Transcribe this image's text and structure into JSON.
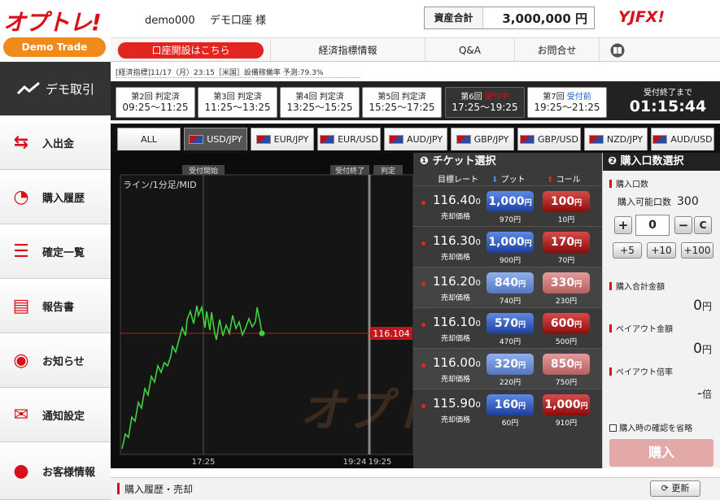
{
  "header": {
    "logo": "オプトレ!",
    "demo_badge": "Demo Trade",
    "user_id": "demo000",
    "user_name": "デモ口座 様",
    "asset_label": "資産合計",
    "asset_value": "3,000,000 円",
    "brand": "YJFX!"
  },
  "topnav": {
    "open_account": "口座開設はこちら",
    "items": [
      "経済指標情報",
      "Q&A",
      "お問合せ"
    ]
  },
  "news": "[経済指標]11/17（月）23:15［米国］設備稼働率 予測:79.3%",
  "sidebar": {
    "title": "デモ取引",
    "items": [
      "入出金",
      "購入履歴",
      "確定一覧",
      "報告書",
      "お知らせ",
      "通知設定",
      "お客様情報"
    ]
  },
  "rounds": [
    {
      "label": "第2回",
      "status": "判定済",
      "time": "09:25〜11:25"
    },
    {
      "label": "第3回",
      "status": "判定済",
      "time": "11:25〜13:25"
    },
    {
      "label": "第4回",
      "status": "判定済",
      "time": "13:25〜15:25"
    },
    {
      "label": "第5回",
      "status": "判定済",
      "time": "15:25〜17:25"
    },
    {
      "label": "第6回",
      "status": "受付中",
      "time": "17:25〜19:25"
    },
    {
      "label": "第7回",
      "status": "受付前",
      "time": "19:25〜21:25"
    }
  ],
  "countdown": {
    "label": "受付終了まで",
    "value": "01:15:44"
  },
  "currency_tabs": [
    "ALL",
    "USD/JPY",
    "EUR/JPY",
    "EUR/USD",
    "AUD/JPY",
    "GBP/JPY",
    "GBP/USD",
    "NZD/JPY",
    "AUD/USD"
  ],
  "chart": {
    "marker_start": "受付開始",
    "marker_end": "受付終了",
    "marker_judge": "判定",
    "line_label": "ライン/1分足/MID",
    "current_price": "116.104",
    "xticks": [
      "17:25",
      "19:24",
      "19:25"
    ],
    "watermark": "オプトレ!",
    "colors": {
      "line": "#3fd23f",
      "price": "#c2161b"
    }
  },
  "tickets": {
    "title": "チケット選択",
    "col_target": "目標レート",
    "col_put": "プット",
    "col_call": "コール",
    "sell_label": "売却価格",
    "rows": [
      {
        "rate": "116.40",
        "sub": "0",
        "put": "1,000",
        "call": "100",
        "put_sell": "970円",
        "call_sell": "10円"
      },
      {
        "rate": "116.30",
        "sub": "0",
        "put": "1,000",
        "call": "170",
        "put_sell": "900円",
        "call_sell": "70円"
      },
      {
        "rate": "116.20",
        "sub": "0",
        "put": "840",
        "call": "330",
        "put_sell": "740円",
        "call_sell": "230円"
      },
      {
        "rate": "116.10",
        "sub": "0",
        "put": "570",
        "call": "600",
        "put_sell": "470円",
        "call_sell": "500円"
      },
      {
        "rate": "116.00",
        "sub": "0",
        "put": "320",
        "call": "850",
        "put_sell": "220円",
        "call_sell": "750円"
      },
      {
        "rate": "115.90",
        "sub": "0",
        "put": "160",
        "call": "1,000",
        "put_sell": "60円",
        "call_sell": "910円"
      }
    ],
    "yen": "円"
  },
  "buy": {
    "title": "購入口数選択",
    "qty_label": "購入口数",
    "avail_label": "購入可能口数",
    "avail_value": "300",
    "qty_value": "0",
    "plus": "+",
    "minus": "−",
    "clear": "C",
    "adds": [
      "+5",
      "+10",
      "+100"
    ],
    "total_label": "購入合計金額",
    "total_value": "0",
    "payout_label": "ペイアウト金額",
    "payout_value": "0",
    "ratio_label": "ペイアウト倍率",
    "ratio_value": "-",
    "ratio_unit": "倍",
    "yen": "円",
    "confirm_label": "購入時の確認を省略",
    "buy_button": "購入"
  },
  "bottom": {
    "title": "購入履歴・売却",
    "refresh": "更新"
  }
}
